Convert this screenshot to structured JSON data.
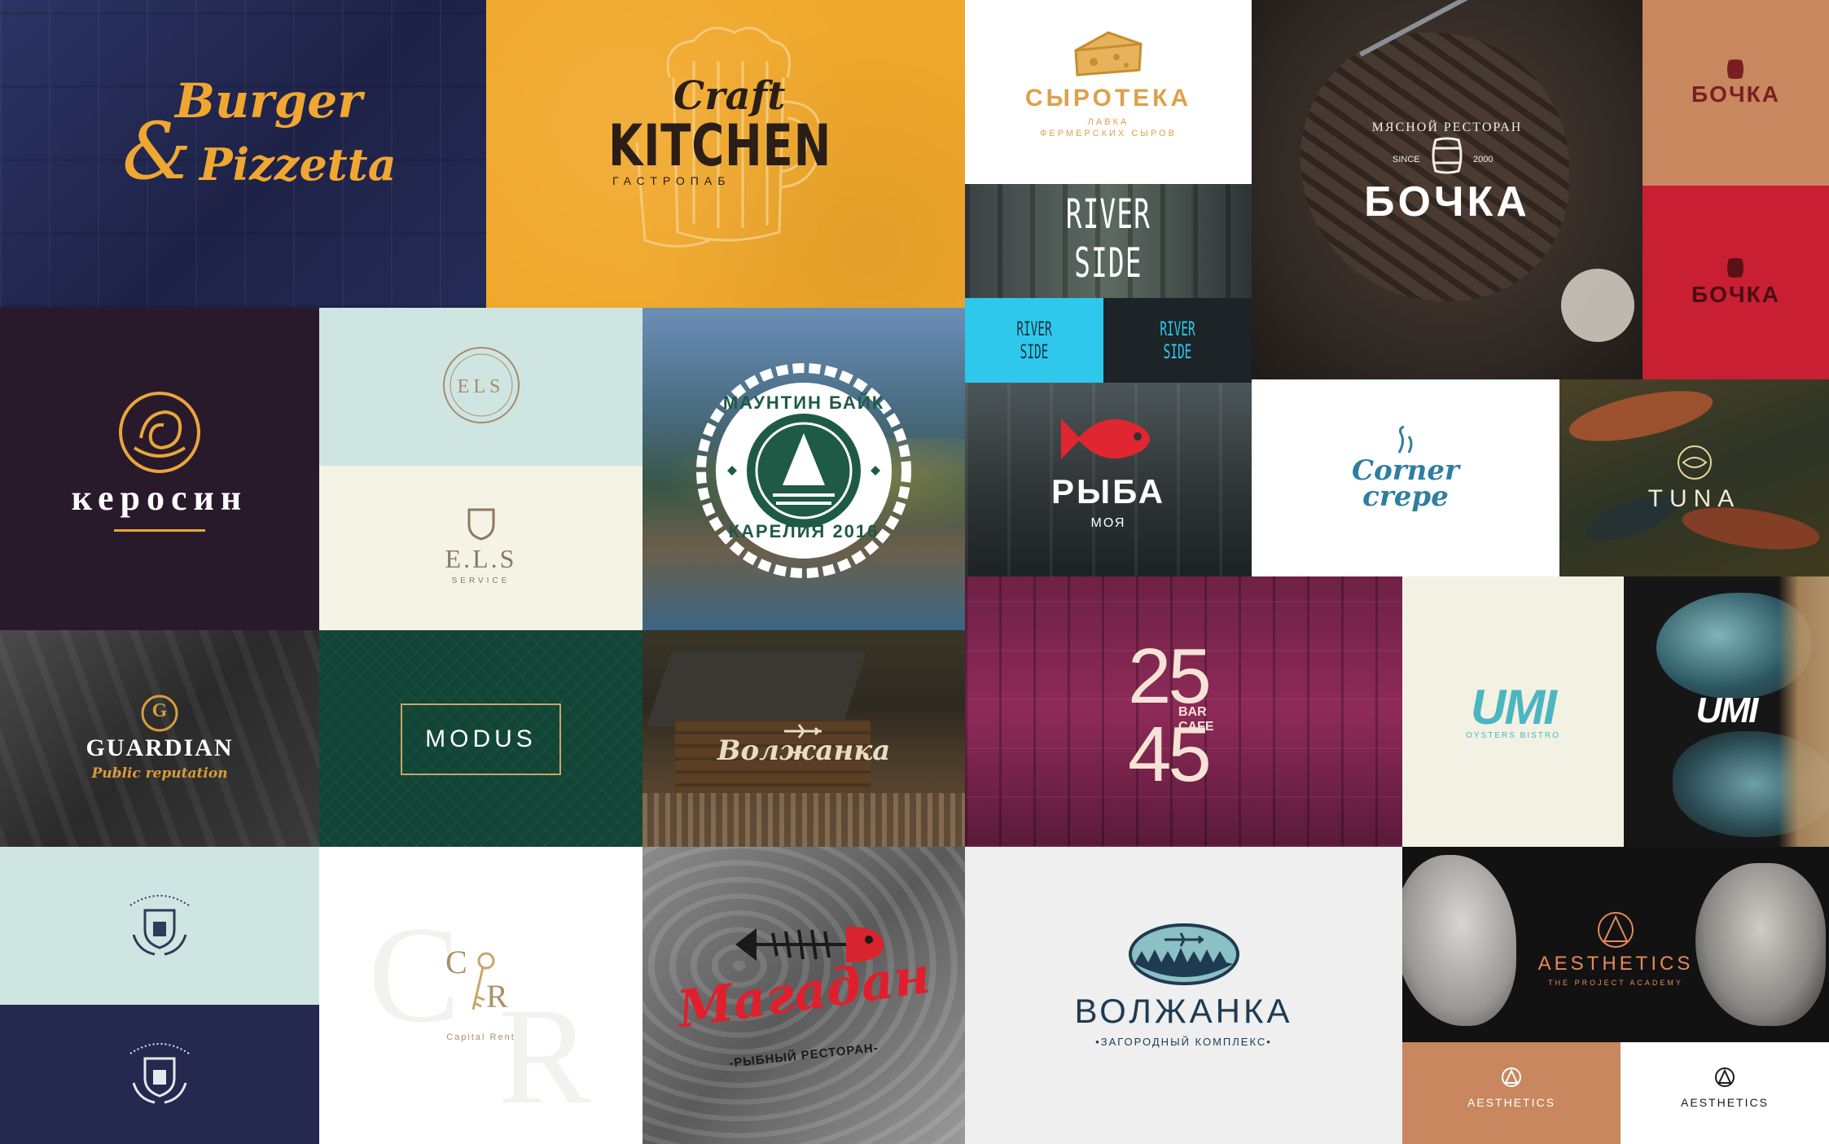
{
  "brands": {
    "burger_pizzetta": {
      "line1": "Burger",
      "amp": "&",
      "line2": "Pizzetta"
    },
    "craft_kitchen": {
      "craft": "Craft",
      "kitchen": "KITCHEN",
      "sub": "ГАСТРОПАБ"
    },
    "syroteka": {
      "name": "СЫРОТЕКА",
      "line1": "ЛАВКА",
      "line2": "ФЕРМЕРСКИХ СЫРОВ"
    },
    "bochka": {
      "arc": "МЯСНОЙ РЕСТОРАН",
      "since": "SINCE",
      "year": "2000",
      "name": "БОЧКА"
    },
    "bochka_small": {
      "name": "БОЧКА"
    },
    "river_side": {
      "line1": "RIVER",
      "line2": "SIDE"
    },
    "kerosin": {
      "name": "керосин"
    },
    "els": {
      "name": "ELS",
      "name2": "E.L.S",
      "sub": "SERVICE"
    },
    "mountain_bike": {
      "top": "МАУНТИН БАЙК",
      "bottom": "КАРЕЛИЯ 2016"
    },
    "ryba": {
      "name": "РЫБА",
      "sub": "МОЯ"
    },
    "corner_crepe": {
      "line1": "Corner",
      "line2": "crepe"
    },
    "tuna": {
      "name": "TUNA"
    },
    "guardian": {
      "letter": "G",
      "name": "GUARDIAN",
      "sub": "Public reputation"
    },
    "modus": {
      "name": "MODUS"
    },
    "volzhanka_cabin": {
      "name": "Волжанка"
    },
    "bar25": {
      "top": "25",
      "bottom": "45",
      "bar": "BAR",
      "cafe": "CAFE"
    },
    "umi": {
      "name": "UMI",
      "sub": "OYSTERS BISTRO"
    },
    "capital_rent": {
      "c": "C",
      "r": "R",
      "name": "Capital Rent"
    },
    "magadan": {
      "name": "Магадан",
      "sub": "-РЫБНЫЙ РЕСТОРАН-"
    },
    "volzhanka": {
      "name": "ВОЛЖАНКА",
      "sub": "•ЗАГОРОДНЫЙ КОМПЛЕКС•"
    },
    "aesthetics": {
      "name": "AESTHETICS",
      "sub": "THE PROJECT ACADEMY"
    }
  },
  "colors": {
    "navy": "#25294f",
    "mustard": "#efa62a",
    "eggplant": "#2a1a2c",
    "mint": "#cfe5e1",
    "green": "#114535",
    "magenta": "#9c2a5a",
    "red": "#c81f32",
    "tan": "#c8875e",
    "cyan": "#2ec8ec",
    "teal": "#4bb6c0",
    "cream": "#f3f1e3",
    "gold": "#e9a63a"
  }
}
